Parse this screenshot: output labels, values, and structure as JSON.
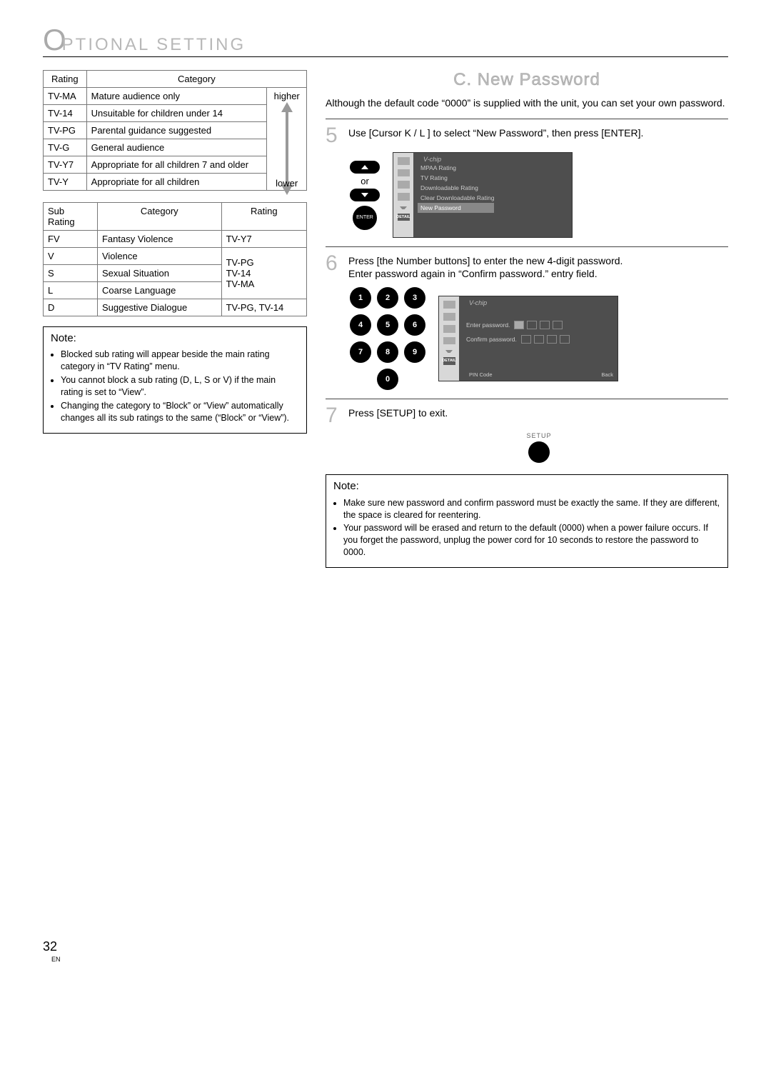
{
  "heading": {
    "letter": "O",
    "rest": "PTIONAL SETTING"
  },
  "rating_table": {
    "headers": {
      "rating": "Rating",
      "category": "Category"
    },
    "rows": [
      {
        "rating": "TV-MA",
        "category": "Mature audience only"
      },
      {
        "rating": "TV-14",
        "category": "Unsuitable for children under 14"
      },
      {
        "rating": "TV-PG",
        "category": "Parental guidance suggested"
      },
      {
        "rating": "TV-G",
        "category": "General audience"
      },
      {
        "rating": "TV-Y7",
        "category": "Appropriate for all children 7 and older"
      },
      {
        "rating": "TV-Y",
        "category": "Appropriate for all children"
      }
    ],
    "higher": "higher",
    "lower": "lower"
  },
  "sub_table": {
    "headers": {
      "sub": "Sub Rating",
      "category": "Category",
      "rating": "Rating"
    },
    "rows": [
      {
        "sub": "FV",
        "category": "Fantasy Violence",
        "rating_single": "TV-Y7"
      },
      {
        "sub": "V",
        "category": "Violence"
      },
      {
        "sub": "S",
        "category": "Sexual Situation"
      },
      {
        "sub": "L",
        "category": "Coarse Language"
      },
      {
        "sub": "D",
        "category": "Suggestive Dialogue",
        "rating_single": "TV-PG, TV-14"
      }
    ],
    "rating_block": [
      "TV-PG",
      "TV-14",
      "TV-MA"
    ]
  },
  "note_left": {
    "title": "Note:",
    "items": [
      "Blocked sub rating will appear beside the main rating category in “TV Rating” menu.",
      "You cannot block a sub rating (D, L, S or V) if the main rating is set to “View”.",
      "Changing the category to “Block” or “View” automatically changes all its sub ratings to the same (“Block” or “View”)."
    ]
  },
  "section_title": "C. New Password",
  "intro": "Although the default code “0000” is supplied with the unit, you can set your own password.",
  "step5": {
    "num": "5",
    "text": "Use [Cursor K / L ] to select “New Password”, then press [ENTER].",
    "or": "or",
    "enter": "ENTER"
  },
  "step6": {
    "num": "6",
    "text": "Press [the Number buttons] to enter the new 4-digit password.",
    "text2": "Enter password again in “Confirm password.” entry field.",
    "keys": [
      "1",
      "2",
      "3",
      "4",
      "5",
      "6",
      "7",
      "8",
      "9",
      "0"
    ]
  },
  "step7": {
    "num": "7",
    "text": "Press [SETUP] to exit.",
    "label": "SETUP"
  },
  "note_right": {
    "title": "Note:",
    "items": [
      "Make sure new password and confirm password must be exactly the same. If they are different, the space is cleared for reentering.",
      "Your password will be erased and return to the default (0000) when a power failure occurs. If you forget the password, unplug the power cord for 10 seconds to restore the password to 0000."
    ]
  },
  "osd1": {
    "title": "V-chip",
    "items": [
      "MPAA Rating",
      "TV Rating",
      "Downloadable Rating",
      "Clear Downloadable Rating",
      "New Password"
    ],
    "selected_index": 4,
    "detail": "DETAIL"
  },
  "osd2": {
    "title": "V-chip",
    "enter_pwd": "Enter password.",
    "confirm_pwd": "Confirm password.",
    "pin": "PIN Code",
    "back": "Back",
    "detail": "DETAIL"
  },
  "page_number": "32",
  "en": "EN"
}
